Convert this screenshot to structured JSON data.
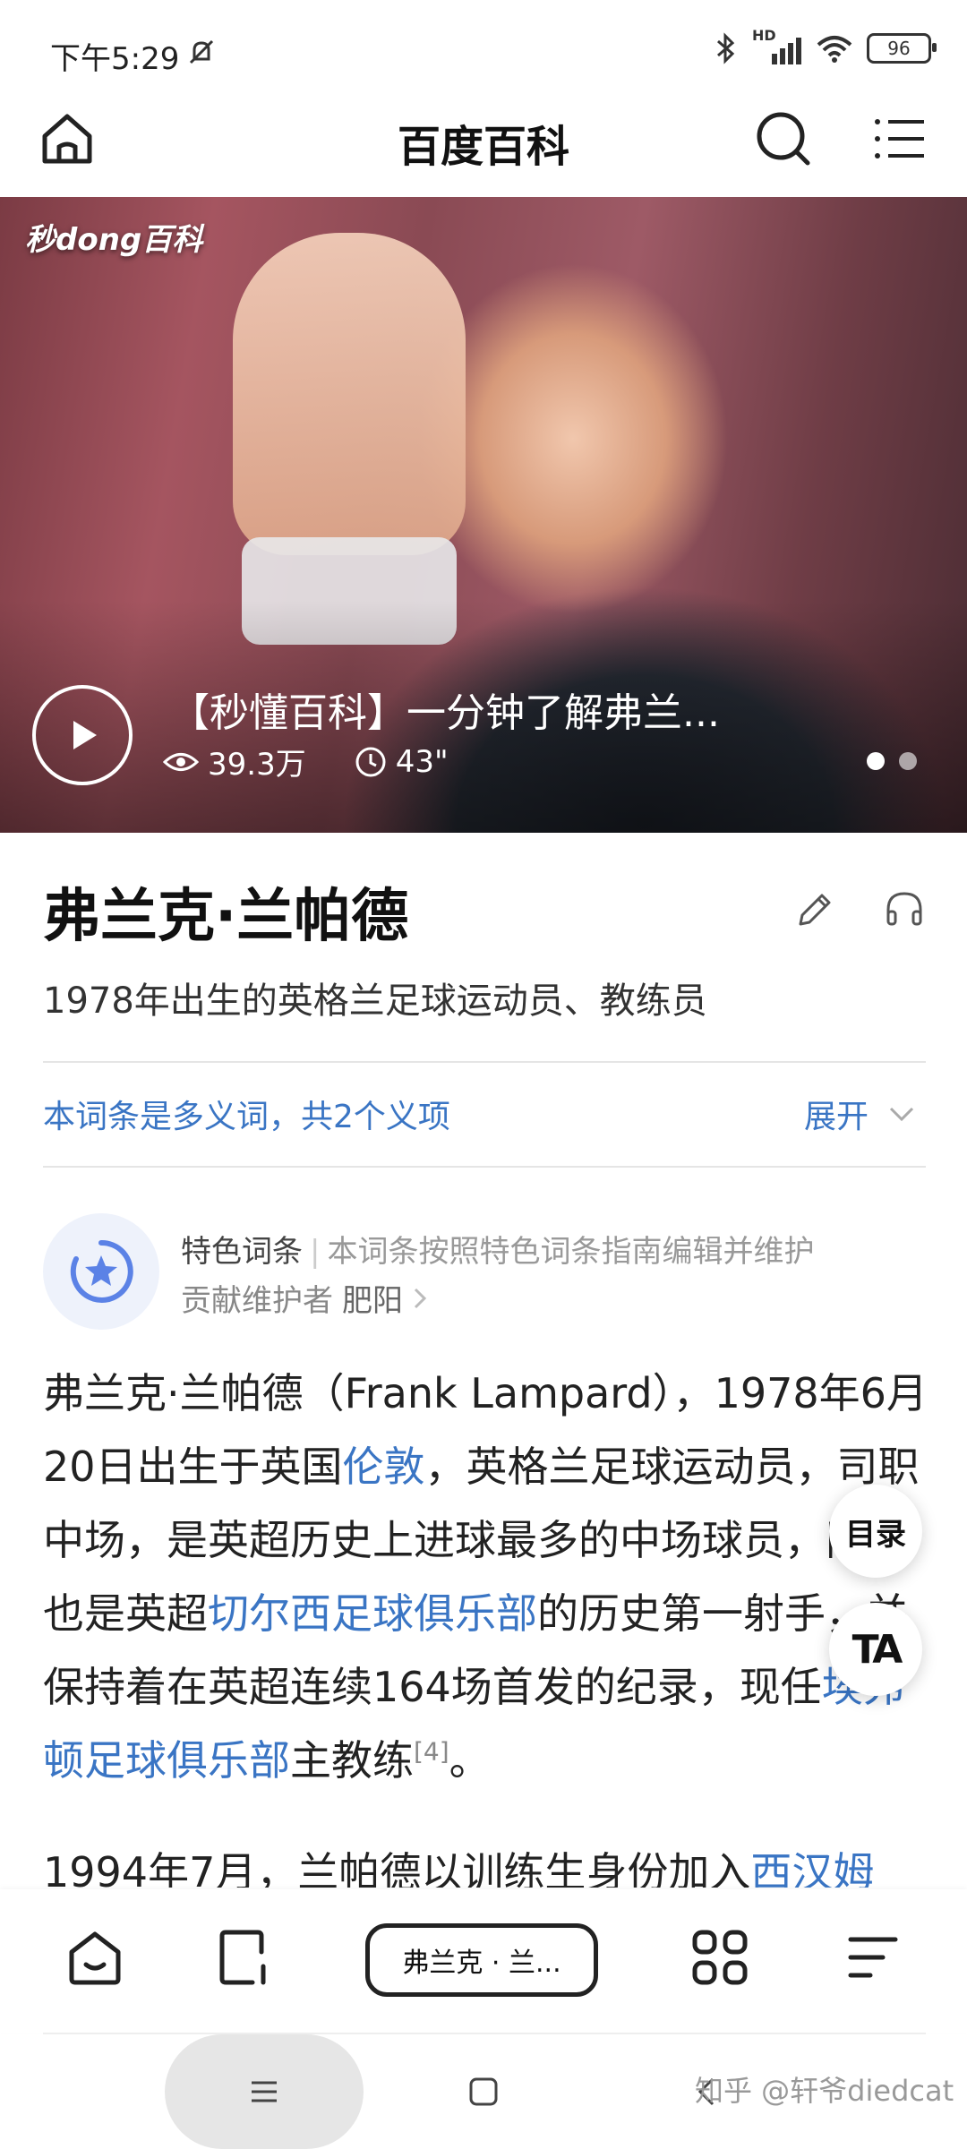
{
  "status_bar": {
    "time": "下午5:29",
    "hd_label": "HD",
    "battery": "96"
  },
  "nav": {
    "title": "百度百科"
  },
  "hero": {
    "brand": "秒dong百科",
    "video_title": "【秒懂百科】一分钟了解弗兰...",
    "views": "39.3万",
    "duration": "43\"",
    "page_count": 2,
    "current_page": 1
  },
  "entry": {
    "title": "弗兰克·兰帕德",
    "subtitle": "1978年出生的英格兰足球运动员、教练员",
    "polysemy": "本词条是多义词，共2个义项",
    "expand": "展开"
  },
  "feature": {
    "label": "特色词条",
    "separator": "|",
    "desc": "本词条按照特色词条指南编辑并维护",
    "contributor_label": "贡献维护者",
    "contributor": "肥阳"
  },
  "body": {
    "p1_a": "弗兰克·兰帕德（Frank Lampard），1978年6月20日出生于英国",
    "p1_link1": "伦敦",
    "p1_b": "，英格兰足球运动员，司职中场，是英超历史上进球最多的中场球员，同时也是英超",
    "p1_link2": "切尔西足球俱乐部",
    "p1_c": "的历史第一射手，并保持着在英超连续164场首发的纪录，现任",
    "p1_link3": "埃弗顿足球俱乐部",
    "p1_d": "主教练",
    "p1_ref": "[4]",
    "p1_end": "。",
    "p2_a": "1994年7月，兰帕德以训练生身份加入",
    "p2_link": "西汉姆"
  },
  "float": {
    "toc": "目录",
    "text_size": "TA"
  },
  "toolbar": {
    "tab_label": "弗兰克 · 兰..."
  },
  "watermark": "知乎 @轩爷diedcat"
}
